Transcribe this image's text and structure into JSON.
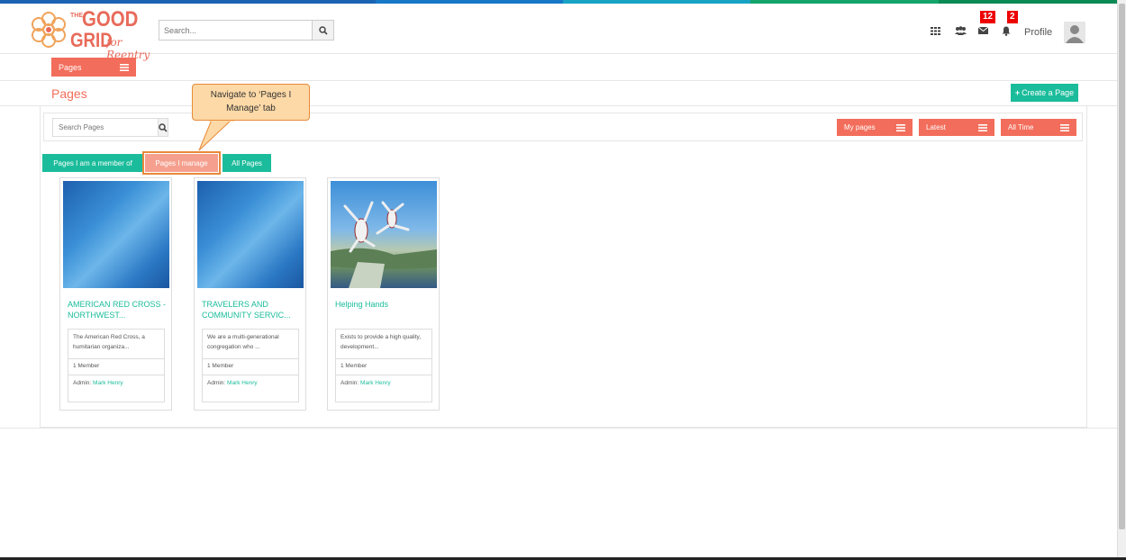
{
  "brand": {
    "logo_the": "THE",
    "logo_good": "GOOD",
    "logo_grid": "GRID",
    "logo_tagline": "for Reentry",
    "stripe_colors": [
      "#1b63b3",
      "#1b63b3",
      "#1878c8",
      "#18a3c4",
      "#13a56b",
      "#0a8a54"
    ]
  },
  "header": {
    "search_placeholder": "Search...",
    "messages_badge": "12",
    "notifications_badge": "2",
    "profile_label": "Profile"
  },
  "subnav": {
    "pages_dropdown": "Pages"
  },
  "page": {
    "title": "Pages",
    "create_button": "Create a Page"
  },
  "filters": {
    "search_placeholder": "Search Pages",
    "my_pages": "My pages",
    "latest": "Latest",
    "all_time": "All Time"
  },
  "tabs": {
    "member": "Pages I am a member of",
    "manage": "Pages I manage",
    "all": "All Pages"
  },
  "callout": {
    "text": "Navigate to ‘Pages I Manage’ tab"
  },
  "cards": [
    {
      "title": "AMERICAN RED CROSS - NORTHWEST...",
      "description": "The American Red Cross, a humitarian organiza...",
      "members": "1 Member",
      "admin_label": "Admin:",
      "admin_name": "Mark Henry"
    },
    {
      "title": "TRAVELERS AND COMMUNITY SERVIC...",
      "description": "We are a multi-generational congregation who ...",
      "members": "1 Member",
      "admin_label": "Admin:",
      "admin_name": "Mark Henry"
    },
    {
      "title": "Helping Hands",
      "description": "Exists to provide a high quality, development...",
      "members": "1 Member",
      "admin_label": "Admin:",
      "admin_name": "Mark Henry"
    }
  ]
}
